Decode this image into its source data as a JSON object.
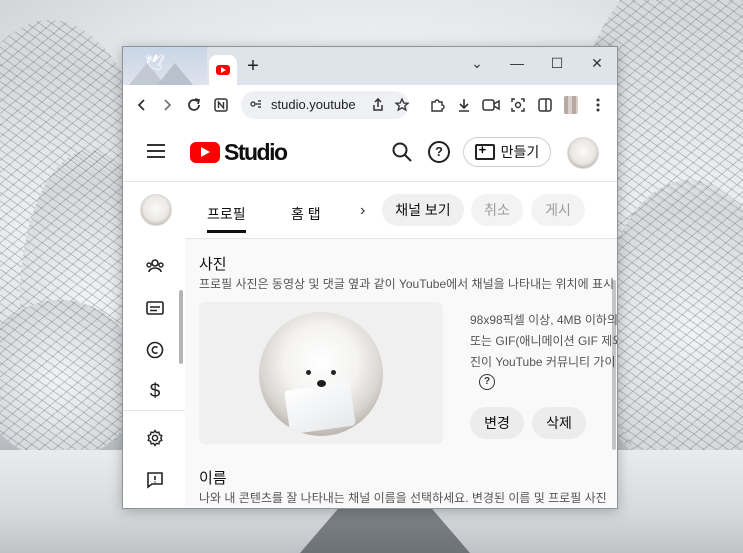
{
  "browser": {
    "new_tab_label": "+",
    "url": "studio.youtube",
    "window_controls": {
      "minimize": "—",
      "maximize": "☐",
      "close": "✕",
      "dropdown": "⌄"
    }
  },
  "studio": {
    "logo_text": "Studio",
    "create_label": "만들기"
  },
  "rail": {
    "icons": [
      "community-icon",
      "subtitles-icon",
      "copyright-icon",
      "monetization-icon",
      "settings-icon",
      "feedback-icon"
    ]
  },
  "tabs": {
    "profile": "프로필",
    "home": "홈 탭",
    "view_channel": "채널 보기",
    "cancel": "취소",
    "publish": "게시"
  },
  "photo": {
    "title": "사진",
    "description": "프로필 사진은 동영상 및 댓글 옆과 같이 YouTube에서 채널을 나타내는 위치에 표시",
    "info_lines": [
      "98x98픽셀 이상, 4MB 이하의",
      "또는 GIF(애니메이션 GIF 제외",
      "진이 YouTube 커뮤니티 가이"
    ],
    "help_symbol": "?",
    "change_label": "변경",
    "delete_label": "삭제"
  },
  "name": {
    "title": "이름",
    "description": "나와 내 콘텐츠를 잘 나타내는 채널 이름을 선택하세요. 변경된 이름 및 프로필 사진"
  }
}
